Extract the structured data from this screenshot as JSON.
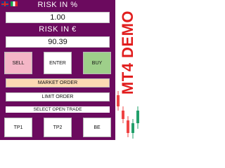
{
  "header": {
    "flags": [
      "united-kingdom-flag",
      "italy-flag"
    ]
  },
  "risk_percent": {
    "label": "RISK IN %",
    "value": "1.00"
  },
  "risk_euro": {
    "label": "RISK IN €",
    "value": "90.39"
  },
  "trade_buttons": {
    "sell": "SELL",
    "enter": "ENTER",
    "buy": "BUY"
  },
  "order_buttons": {
    "market": "MARKET ORDER",
    "limit": "LIMIT ORDER"
  },
  "select_open_trade": "SELECT OPEN TRADE",
  "trade_actions": {
    "tp1": "TP1",
    "tp2": "TP2",
    "be": "BE"
  },
  "watermark": "MT4 DEMO",
  "colors": {
    "panel": "#6b0a5e",
    "sell": "#f4b6c6",
    "buy": "#9ecf8a",
    "market": "#fcd9b3",
    "watermark": "#e11d1d",
    "candle_up": "#22a06b",
    "candle_down": "#ef4444"
  }
}
